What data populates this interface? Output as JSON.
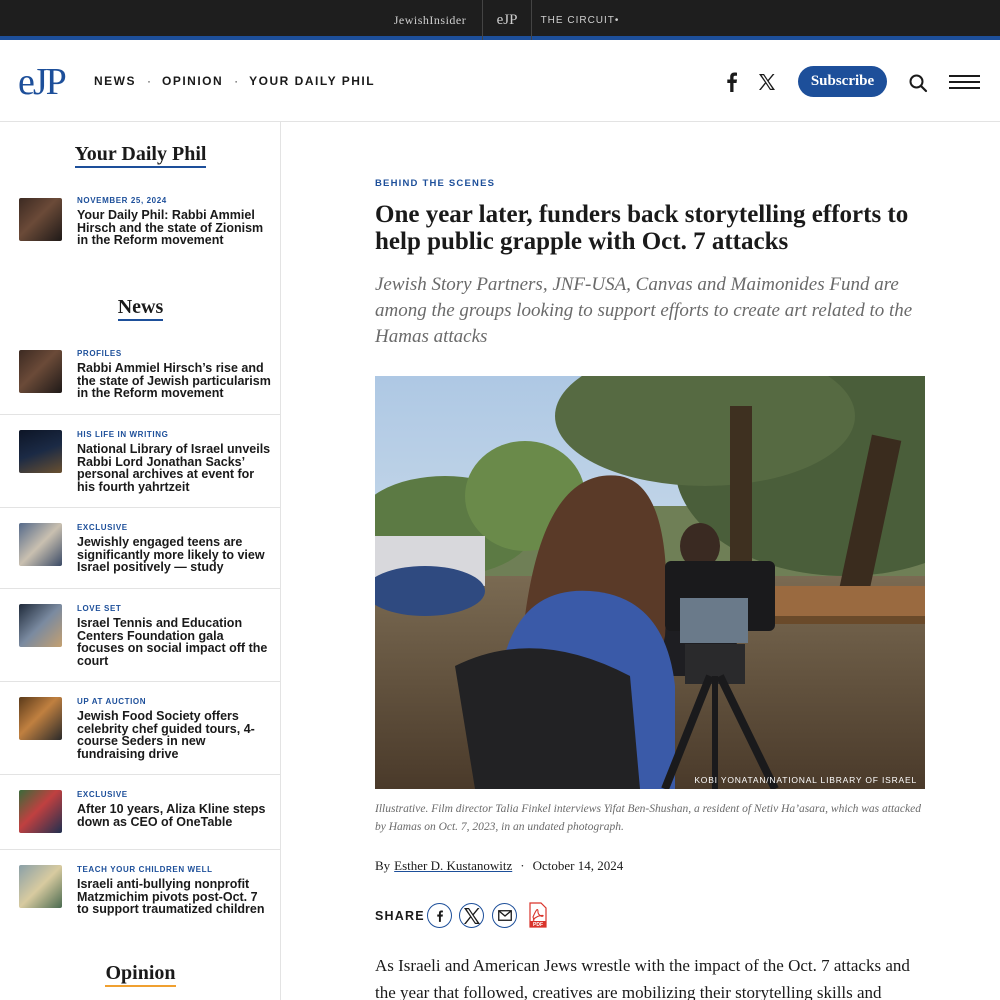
{
  "network_bar": {
    "jewish_insider": "JewishInsider",
    "ejp": "eJP",
    "the_circuit": "THE CIRCUIT•"
  },
  "header": {
    "logo": "eJP",
    "nav": [
      "NEWS",
      "OPINION",
      "YOUR DAILY PHIL"
    ],
    "subscribe": "Subscribe",
    "icons": [
      "facebook-icon",
      "x-icon",
      "search-icon",
      "menu-icon"
    ]
  },
  "colors": {
    "brand_blue": "#1d4f9a",
    "opinion_accent": "#f0a030",
    "dark_bar": "#1e1e1e"
  },
  "sidebar": {
    "daily_phil": {
      "heading": "Your Daily Phil",
      "items": [
        {
          "kicker": "NOVEMBER 25, 2024",
          "title": "Your Daily Phil: Rabbi Ammiel Hirsch and the state of Zionism in the Reform movement"
        }
      ]
    },
    "news": {
      "heading": "News",
      "items": [
        {
          "kicker": "PROFILES",
          "title": "Rabbi Ammiel Hirsch’s rise and the state of Jewish particularism in the Reform movement"
        },
        {
          "kicker": "HIS LIFE IN WRITING",
          "title": "National Library of Israel unveils Rabbi Lord Jonathan Sacks’ personal archives at event for his fourth yahrtzeit"
        },
        {
          "kicker": "EXCLUSIVE",
          "title": "Jewishly engaged teens are significantly more likely to view Israel positively — study"
        },
        {
          "kicker": "LOVE SET",
          "title": "Israel Tennis and Education Centers Foundation gala focuses on social impact off the court"
        },
        {
          "kicker": "UP AT AUCTION",
          "title": "Jewish Food Society offers celebrity chef guided tours, 4-course Seders in new fundraising drive"
        },
        {
          "kicker": "EXCLUSIVE",
          "title": "After 10 years, Aliza Kline steps down as CEO of OneTable"
        },
        {
          "kicker": "TEACH YOUR CHILDREN WELL",
          "title": "Israeli anti-bullying nonprofit Matzmichim pivots post-Oct. 7 to support traumatized children"
        }
      ]
    },
    "opinion": {
      "heading": "Opinion"
    }
  },
  "article": {
    "kicker": "BEHIND THE SCENES",
    "title": "One year later, funders back storytelling efforts to help public grapple with Oct. 7 attacks",
    "dek": "Jewish Story Partners, JNF-USA, Canvas and Maimonides Fund are among the groups looking to support efforts to create art related to the Hamas attacks",
    "photo_credit": "KOBI YONATAN/NATIONAL LIBRARY OF ISRAEL",
    "caption": "Illustrative. Film director Talia Finkel interviews Yifat Ben-Shushan, a resident of Netiv Ha’asara, which was attacked by Hamas on Oct. 7, 2023, in an undated photograph.",
    "byline_prefix": "By",
    "author": "Esther D. Kustanowitz",
    "date": "October 14, 2024",
    "share_label": "SHARE",
    "share_icons": [
      "facebook-icon",
      "x-icon",
      "email-icon",
      "pdf-icon"
    ],
    "body_start": "As Israeli and American Jews wrestle with the impact of the Oct. 7 attacks and the year that followed, creatives are mobilizing their storytelling skills and"
  }
}
